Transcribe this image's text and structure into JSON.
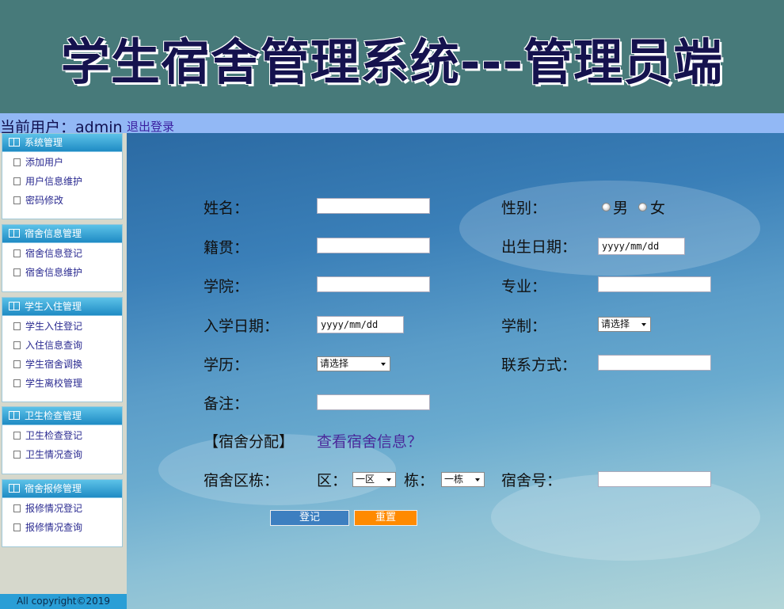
{
  "header": {
    "title": "学生宿舍管理系统---管理员端"
  },
  "userbar": {
    "label": "当前用户：admin",
    "logout": "退出登录"
  },
  "sidebar": {
    "groups": [
      {
        "title": "系统管理",
        "items": [
          "添加用户",
          "用户信息维护",
          "密码修改"
        ]
      },
      {
        "title": "宿舍信息管理",
        "items": [
          "宿舍信息登记",
          "宿舍信息维护"
        ]
      },
      {
        "title": "学生入住管理",
        "items": [
          "学生入住登记",
          "入住信息查询",
          "学生宿舍调换",
          "学生离校管理"
        ]
      },
      {
        "title": "卫生检查管理",
        "items": [
          "卫生检查登记",
          "卫生情况查询"
        ]
      },
      {
        "title": "宿舍报修管理",
        "items": [
          "报修情况登记",
          "报修情况查询"
        ]
      }
    ],
    "copyright": "All copyright©2019"
  },
  "form": {
    "name_label": "姓名：",
    "gender_label": "性别：",
    "gender_male": "男",
    "gender_female": "女",
    "hometown_label": "籍贯：",
    "birth_label": "出生日期：",
    "birth_placeholder": "yyyy/mm/dd",
    "college_label": "学院：",
    "major_label": "专业：",
    "enroll_label": "入学日期：",
    "enroll_placeholder": "yyyy/mm/dd",
    "length_label": "学制：",
    "length_value": "请选择",
    "edu_label": "学历：",
    "edu_value": "请选择",
    "contact_label": "联系方式：",
    "remark_label": "备注：",
    "assign_label": "【宿舍分配】",
    "assign_link": "查看宿舍信息？",
    "area_label": "宿舍区栋：",
    "zone_label": "区：",
    "zone_value": "一区",
    "building_label": "栋：",
    "building_value": "一栋",
    "room_label": "宿舍号：",
    "submit": "登记",
    "reset": "重置"
  },
  "colors": {
    "header": "#477a7a",
    "userbar": "#92b8f5",
    "submit": "#3d7fc0",
    "reset": "#ff8a00"
  }
}
